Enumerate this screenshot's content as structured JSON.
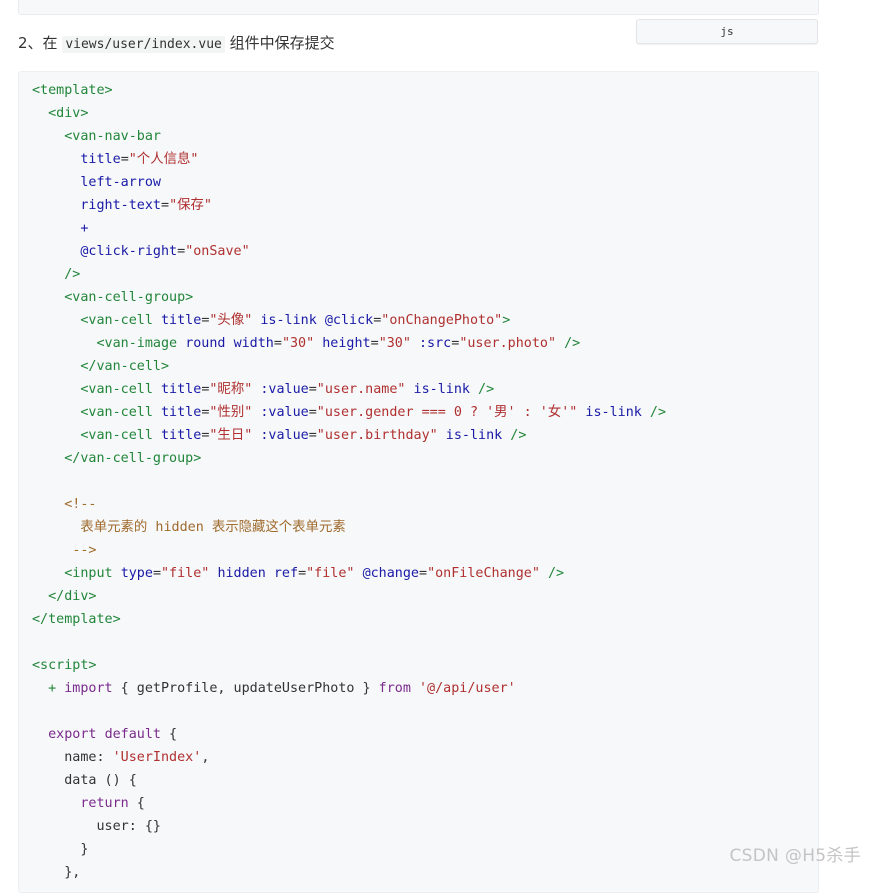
{
  "lang_tab": {
    "label": "js"
  },
  "step": {
    "prefix": "2、在 ",
    "path": "views/user/index.vue",
    "suffix": " 组件中保存提交"
  },
  "code": {
    "lines": [
      [
        {
          "t": "tag",
          "v": "<template>"
        }
      ],
      [
        {
          "t": "plain",
          "v": "  "
        },
        {
          "t": "tag",
          "v": "<div>"
        }
      ],
      [
        {
          "t": "plain",
          "v": "    "
        },
        {
          "t": "tag",
          "v": "<van-nav-bar"
        }
      ],
      [
        {
          "t": "plain",
          "v": "      "
        },
        {
          "t": "attr",
          "v": "title"
        },
        {
          "t": "plain",
          "v": "="
        },
        {
          "t": "str",
          "v": "\"个人信息\""
        }
      ],
      [
        {
          "t": "plain",
          "v": "      "
        },
        {
          "t": "attr",
          "v": "left-arrow"
        }
      ],
      [
        {
          "t": "plain",
          "v": "      "
        },
        {
          "t": "attr",
          "v": "right-text"
        },
        {
          "t": "plain",
          "v": "="
        },
        {
          "t": "str",
          "v": "\"保存\""
        }
      ],
      [
        {
          "t": "plain",
          "v": "      "
        },
        {
          "t": "attr",
          "v": "+"
        }
      ],
      [
        {
          "t": "plain",
          "v": "      "
        },
        {
          "t": "attr",
          "v": "@click-right"
        },
        {
          "t": "plain",
          "v": "="
        },
        {
          "t": "str",
          "v": "\"onSave\""
        }
      ],
      [
        {
          "t": "plain",
          "v": "    "
        },
        {
          "t": "tag",
          "v": "/>"
        }
      ],
      [
        {
          "t": "plain",
          "v": "    "
        },
        {
          "t": "tag",
          "v": "<van-cell-group>"
        }
      ],
      [
        {
          "t": "plain",
          "v": "      "
        },
        {
          "t": "tag",
          "v": "<van-cell"
        },
        {
          "t": "plain",
          "v": " "
        },
        {
          "t": "attr",
          "v": "title"
        },
        {
          "t": "plain",
          "v": "="
        },
        {
          "t": "str",
          "v": "\"头像\""
        },
        {
          "t": "plain",
          "v": " "
        },
        {
          "t": "attr",
          "v": "is-link"
        },
        {
          "t": "plain",
          "v": " "
        },
        {
          "t": "attr",
          "v": "@click"
        },
        {
          "t": "plain",
          "v": "="
        },
        {
          "t": "str",
          "v": "\"onChangePhoto\""
        },
        {
          "t": "tag",
          "v": ">"
        }
      ],
      [
        {
          "t": "plain",
          "v": "        "
        },
        {
          "t": "tag",
          "v": "<van-image"
        },
        {
          "t": "plain",
          "v": " "
        },
        {
          "t": "attr",
          "v": "round"
        },
        {
          "t": "plain",
          "v": " "
        },
        {
          "t": "attr",
          "v": "width"
        },
        {
          "t": "plain",
          "v": "="
        },
        {
          "t": "str",
          "v": "\"30\""
        },
        {
          "t": "plain",
          "v": " "
        },
        {
          "t": "attr",
          "v": "height"
        },
        {
          "t": "plain",
          "v": "="
        },
        {
          "t": "str",
          "v": "\"30\""
        },
        {
          "t": "plain",
          "v": " "
        },
        {
          "t": "attr",
          "v": ":src"
        },
        {
          "t": "plain",
          "v": "="
        },
        {
          "t": "str",
          "v": "\"user.photo\""
        },
        {
          "t": "plain",
          "v": " "
        },
        {
          "t": "tag",
          "v": "/>"
        }
      ],
      [
        {
          "t": "plain",
          "v": "      "
        },
        {
          "t": "tag",
          "v": "</van-cell>"
        }
      ],
      [
        {
          "t": "plain",
          "v": "      "
        },
        {
          "t": "tag",
          "v": "<van-cell"
        },
        {
          "t": "plain",
          "v": " "
        },
        {
          "t": "attr",
          "v": "title"
        },
        {
          "t": "plain",
          "v": "="
        },
        {
          "t": "str",
          "v": "\"昵称\""
        },
        {
          "t": "plain",
          "v": " "
        },
        {
          "t": "attr",
          "v": ":value"
        },
        {
          "t": "plain",
          "v": "="
        },
        {
          "t": "str",
          "v": "\"user.name\""
        },
        {
          "t": "plain",
          "v": " "
        },
        {
          "t": "attr",
          "v": "is-link"
        },
        {
          "t": "plain",
          "v": " "
        },
        {
          "t": "tag",
          "v": "/>"
        }
      ],
      [
        {
          "t": "plain",
          "v": "      "
        },
        {
          "t": "tag",
          "v": "<van-cell"
        },
        {
          "t": "plain",
          "v": " "
        },
        {
          "t": "attr",
          "v": "title"
        },
        {
          "t": "plain",
          "v": "="
        },
        {
          "t": "str",
          "v": "\"性别\""
        },
        {
          "t": "plain",
          "v": " "
        },
        {
          "t": "attr",
          "v": ":value"
        },
        {
          "t": "plain",
          "v": "="
        },
        {
          "t": "str",
          "v": "\"user.gender === 0 ? '男' : '女'\""
        },
        {
          "t": "plain",
          "v": " "
        },
        {
          "t": "attr",
          "v": "is-link"
        },
        {
          "t": "plain",
          "v": " "
        },
        {
          "t": "tag",
          "v": "/>"
        }
      ],
      [
        {
          "t": "plain",
          "v": "      "
        },
        {
          "t": "tag",
          "v": "<van-cell"
        },
        {
          "t": "plain",
          "v": " "
        },
        {
          "t": "attr",
          "v": "title"
        },
        {
          "t": "plain",
          "v": "="
        },
        {
          "t": "str",
          "v": "\"生日\""
        },
        {
          "t": "plain",
          "v": " "
        },
        {
          "t": "attr",
          "v": ":value"
        },
        {
          "t": "plain",
          "v": "="
        },
        {
          "t": "str",
          "v": "\"user.birthday\""
        },
        {
          "t": "plain",
          "v": " "
        },
        {
          "t": "attr",
          "v": "is-link"
        },
        {
          "t": "plain",
          "v": " "
        },
        {
          "t": "tag",
          "v": "/>"
        }
      ],
      [
        {
          "t": "plain",
          "v": "    "
        },
        {
          "t": "tag",
          "v": "</van-cell-group>"
        }
      ],
      [
        {
          "t": "plain",
          "v": ""
        }
      ],
      [
        {
          "t": "plain",
          "v": "    "
        },
        {
          "t": "com",
          "v": "<!--"
        }
      ],
      [
        {
          "t": "plain",
          "v": "      "
        },
        {
          "t": "com",
          "v": "表单元素的 hidden 表示隐藏这个表单元素"
        }
      ],
      [
        {
          "t": "plain",
          "v": "     "
        },
        {
          "t": "com",
          "v": "-->"
        }
      ],
      [
        {
          "t": "plain",
          "v": "    "
        },
        {
          "t": "tag",
          "v": "<input"
        },
        {
          "t": "plain",
          "v": " "
        },
        {
          "t": "attr",
          "v": "type"
        },
        {
          "t": "plain",
          "v": "="
        },
        {
          "t": "str",
          "v": "\"file\""
        },
        {
          "t": "plain",
          "v": " "
        },
        {
          "t": "attr",
          "v": "hidden"
        },
        {
          "t": "plain",
          "v": " "
        },
        {
          "t": "attr",
          "v": "ref"
        },
        {
          "t": "plain",
          "v": "="
        },
        {
          "t": "str",
          "v": "\"file\""
        },
        {
          "t": "plain",
          "v": " "
        },
        {
          "t": "attr",
          "v": "@change"
        },
        {
          "t": "plain",
          "v": "="
        },
        {
          "t": "str",
          "v": "\"onFileChange\""
        },
        {
          "t": "plain",
          "v": " "
        },
        {
          "t": "tag",
          "v": "/>"
        }
      ],
      [
        {
          "t": "plain",
          "v": "  "
        },
        {
          "t": "tag",
          "v": "</div>"
        }
      ],
      [
        {
          "t": "tag",
          "v": "</template>"
        }
      ],
      [
        {
          "t": "plain",
          "v": ""
        }
      ],
      [
        {
          "t": "tag",
          "v": "<script>"
        }
      ],
      [
        {
          "t": "plain",
          "v": "  "
        },
        {
          "t": "add",
          "v": "+"
        },
        {
          "t": "plain",
          "v": " "
        },
        {
          "t": "kw",
          "v": "import"
        },
        {
          "t": "plain",
          "v": " { getProfile, updateUserPhoto } "
        },
        {
          "t": "kw",
          "v": "from"
        },
        {
          "t": "plain",
          "v": " "
        },
        {
          "t": "str",
          "v": "'@/api/user'"
        }
      ],
      [
        {
          "t": "plain",
          "v": ""
        }
      ],
      [
        {
          "t": "plain",
          "v": "  "
        },
        {
          "t": "kw",
          "v": "export"
        },
        {
          "t": "plain",
          "v": " "
        },
        {
          "t": "kw",
          "v": "default"
        },
        {
          "t": "plain",
          "v": " {"
        }
      ],
      [
        {
          "t": "plain",
          "v": "    name: "
        },
        {
          "t": "str",
          "v": "'UserIndex'"
        },
        {
          "t": "plain",
          "v": ","
        }
      ],
      [
        {
          "t": "plain",
          "v": "    data () {"
        }
      ],
      [
        {
          "t": "plain",
          "v": "      "
        },
        {
          "t": "kw",
          "v": "return"
        },
        {
          "t": "plain",
          "v": " {"
        }
      ],
      [
        {
          "t": "plain",
          "v": "        user: {}"
        }
      ],
      [
        {
          "t": "plain",
          "v": "      }"
        }
      ],
      [
        {
          "t": "plain",
          "v": "    },"
        }
      ]
    ]
  },
  "watermark": {
    "text": "CSDN @H5杀手"
  }
}
